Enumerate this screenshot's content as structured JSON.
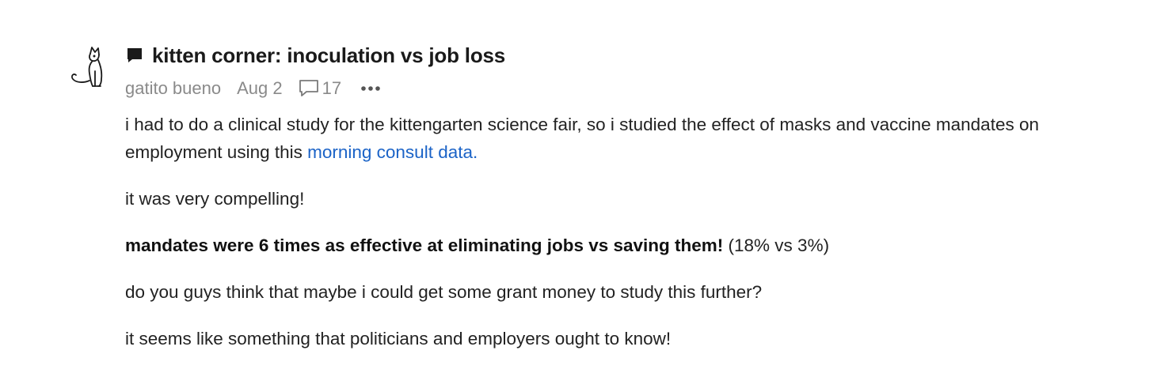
{
  "post": {
    "title": "kitten corner: inoculation vs job loss",
    "author": "gatito bueno",
    "date": "Aug 2",
    "comment_count": "17",
    "paragraphs": {
      "p1_text": "i had to do a clinical study for the kittengarten science fair, so i studied the effect of masks and vaccine mandates on employment using this ",
      "p1_link": "morning consult data.",
      "p2": "it was very compelling!",
      "p3_bold": "mandates were 6 times as effective at eliminating jobs vs saving them!",
      "p3_rest": " (18% vs 3%)",
      "p4": "do you guys think that maybe i could get some grant money to study this further?",
      "p5": "it seems like something that politicians and employers ought to know!"
    }
  },
  "icons": {
    "avatar": "cat-sketch-icon",
    "title": "speech-bubble-icon",
    "comments": "comment-icon",
    "more": "more-options-icon"
  },
  "colors": {
    "link": "#1b63c7",
    "meta": "#8a8a8a",
    "text": "#222222"
  }
}
